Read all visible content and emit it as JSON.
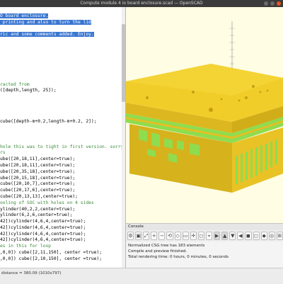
{
  "window": {
    "title": "Compute module 4 io board enclosure.scad — OpenSCAD"
  },
  "editor": {
    "lines": [
      {
        "text": "",
        "sel": false
      },
      {
        "text": "O board enclosure.",
        "sel": true
      },
      {
        "text": " printing and also to turn the lid",
        "sel": true
      },
      {
        "text": "",
        "sel": false
      },
      {
        "text": "ric and some comments added. Enjoy.",
        "sel": true
      },
      {
        "text": "",
        "sel": false
      },
      {
        "text": "",
        "sel": false
      },
      {
        "text": "",
        "sel": false
      },
      {
        "text": "",
        "sel": false
      },
      {
        "text": "",
        "sel": false
      },
      {
        "text": "",
        "sel": false
      },
      {
        "text": "",
        "sel": false
      },
      {
        "text": "racted from",
        "sel": false
      },
      {
        "text": "([depth,length, 25]);",
        "sel": false
      },
      {
        "text": "",
        "sel": false
      },
      {
        "text": "",
        "sel": false
      },
      {
        "text": "",
        "sel": false
      },
      {
        "text": "",
        "sel": false
      },
      {
        "text": "cube([depth-m+0.2,length-m+0.2, 2]);",
        "sel": false
      },
      {
        "text": "",
        "sel": false
      },
      {
        "text": "",
        "sel": false
      },
      {
        "text": "",
        "sel": false
      },
      {
        "text": "hole this was to tight in first version. sorry.",
        "sel": false
      },
      {
        "text": "rs",
        "sel": false
      },
      {
        "text": "ube([20,18,11],center=true);",
        "sel": false
      },
      {
        "text": "ube([20,18,11],center=true);",
        "sel": false
      },
      {
        "text": "ube([20,35,18],center=true);",
        "sel": false
      },
      {
        "text": "ube([20,15,18],center=true);",
        "sel": false
      },
      {
        "text": "cube([20,10,7],center=true);",
        "sel": false
      },
      {
        "text": "cube([20,17,6],center=true);",
        "sel": false
      },
      {
        "text": "cube([20,13,13],center=true);",
        "sel": false
      },
      {
        "text": "ooling of SOC with holes on 4 sides",
        "sel": false
      },
      {
        "text": "ylinder(40,2,2,center=true);",
        "sel": false
      },
      {
        "text": "ylinder(6,2,6,center=true);",
        "sel": false
      },
      {
        "text": "42])cylinder(4,6,4,center=true);",
        "sel": false
      },
      {
        "text": "42])cylinder(4,6,4,center=true);",
        "sel": false
      },
      {
        "text": "42])cylinder(4,6,4,center=true);",
        "sel": false
      },
      {
        "text": "42])cylinder(4,6,4,center=true);",
        "sel": false
      },
      {
        "text": "es in this for loop",
        "sel": false
      },
      {
        "text": ",0,0]) cube([2,11,150], center =true);",
        "sel": false
      },
      {
        "text": ",0,0]) cube([2,10,150], center =true);",
        "sel": false
      },
      {
        "text": "",
        "sel": false
      }
    ]
  },
  "console": {
    "heading": "Console",
    "lines": [
      "Normalized CSG tree has 183 elements",
      "Compile and preview finished.",
      "Total rendering time: 0 hours, 0 minutes, 0 seconds"
    ]
  },
  "toolbar": {
    "icons": [
      "preview-icon",
      "render-icon",
      "view-all-icon",
      "zoom-in-icon",
      "zoom-out-icon",
      "reset-view-icon",
      "perspective-icon",
      "orthogonal-icon",
      "axes-icon",
      "edges-icon",
      "crosshair-icon",
      "right-view-icon",
      "top-view-icon",
      "bottom-view-icon",
      "left-view-icon",
      "front-view-icon",
      "back-view-icon",
      "diagonal-view-icon",
      "center-view-icon",
      "show-scale-icon"
    ]
  },
  "status": {
    "text": "distance = 380.09 (1010x797)"
  },
  "colors": {
    "model_yellow": "#f1cd2a",
    "model_dark": "#c9a617",
    "model_green": "#8fdc4f",
    "viewport_bg": "#fffde3",
    "selection": "#3a76d0",
    "titlebar": "#3b3b3b"
  }
}
